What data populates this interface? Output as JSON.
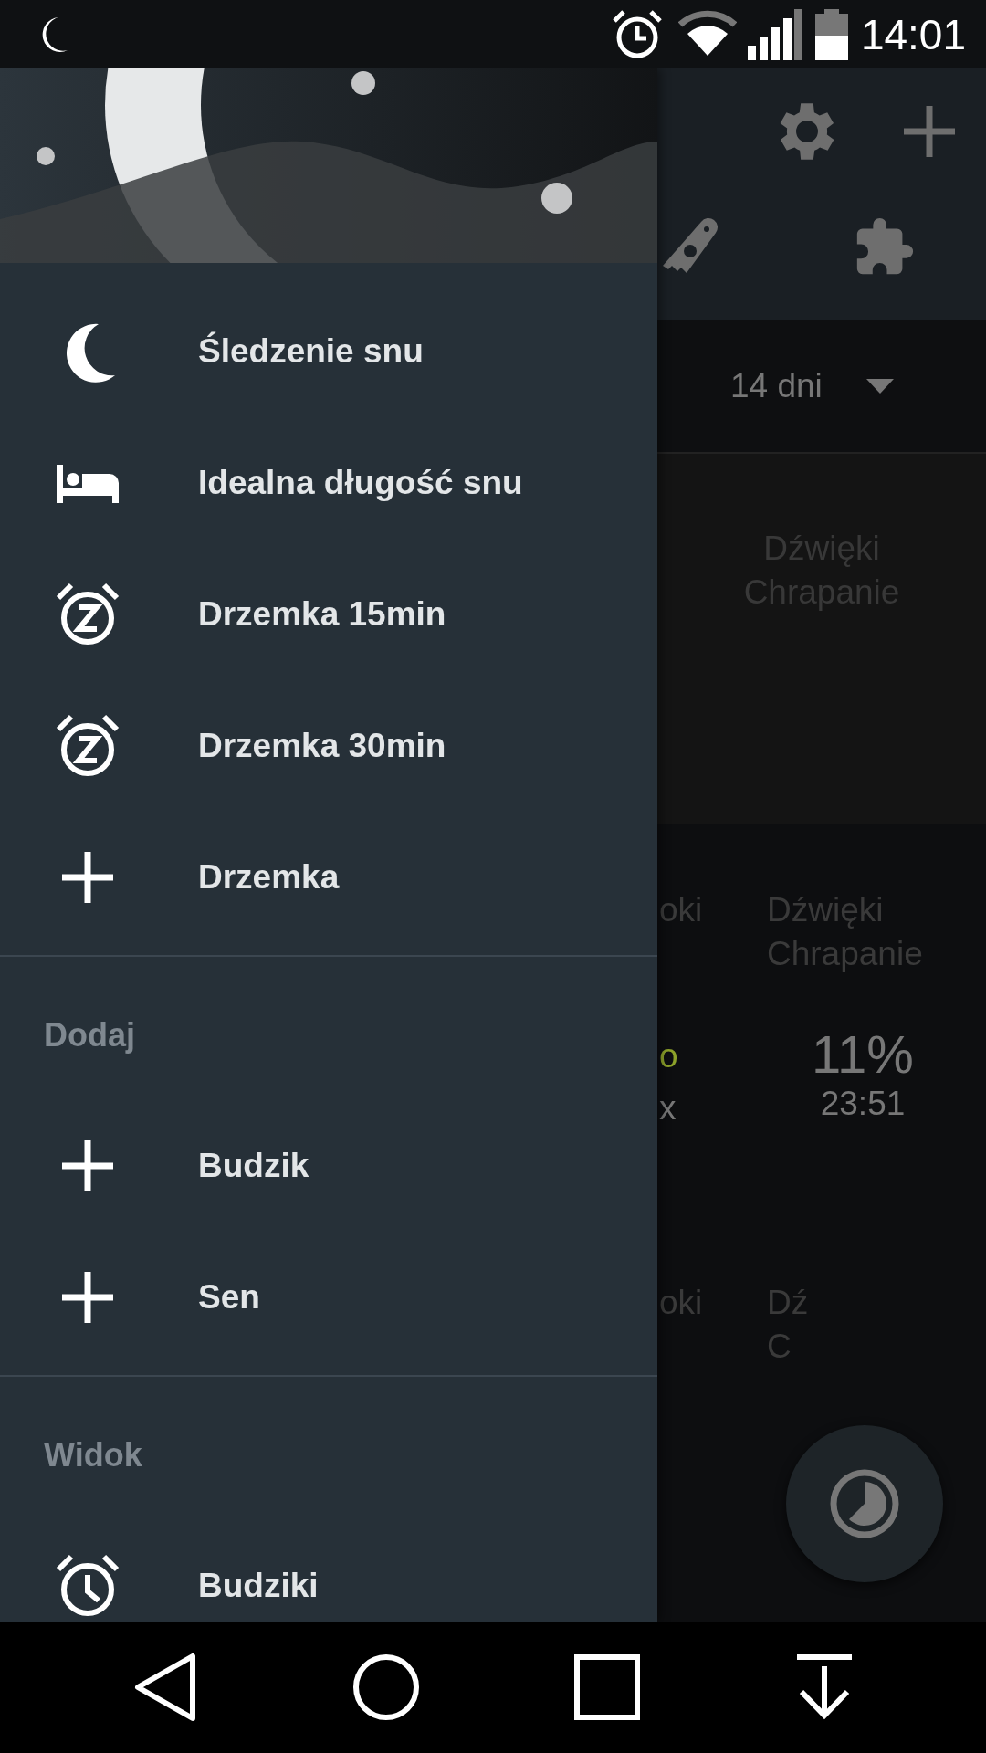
{
  "status_bar": {
    "time": "14:01"
  },
  "drawer": {
    "items": [
      {
        "label": "Śledzenie snu",
        "kind": "moon"
      },
      {
        "label": "Idealna długość snu",
        "kind": "bed"
      },
      {
        "label": "Drzemka 15min",
        "kind": "snooze"
      },
      {
        "label": "Drzemka 30min",
        "kind": "snooze"
      },
      {
        "label": "Drzemka",
        "kind": "plus"
      }
    ],
    "sections": [
      {
        "title": "Dodaj",
        "items": [
          {
            "label": "Budzik",
            "kind": "plus"
          },
          {
            "label": "Sen",
            "kind": "plus"
          }
        ]
      },
      {
        "title": "Widok",
        "items": [
          {
            "label": "Budziki",
            "kind": "alarm"
          }
        ]
      }
    ]
  },
  "background": {
    "range": "14 dni",
    "card_tags": [
      "Dźwięki",
      "Chrapanie"
    ],
    "record": {
      "column_1": "oki",
      "tags": [
        "Dźwięki",
        "Chrapanie"
      ],
      "value_1": "o",
      "value_2": "x",
      "percent": "11%",
      "time": "23:51"
    },
    "record_2": {
      "column_1": "oki",
      "tags": [
        "Dź",
        "C"
      ]
    }
  }
}
